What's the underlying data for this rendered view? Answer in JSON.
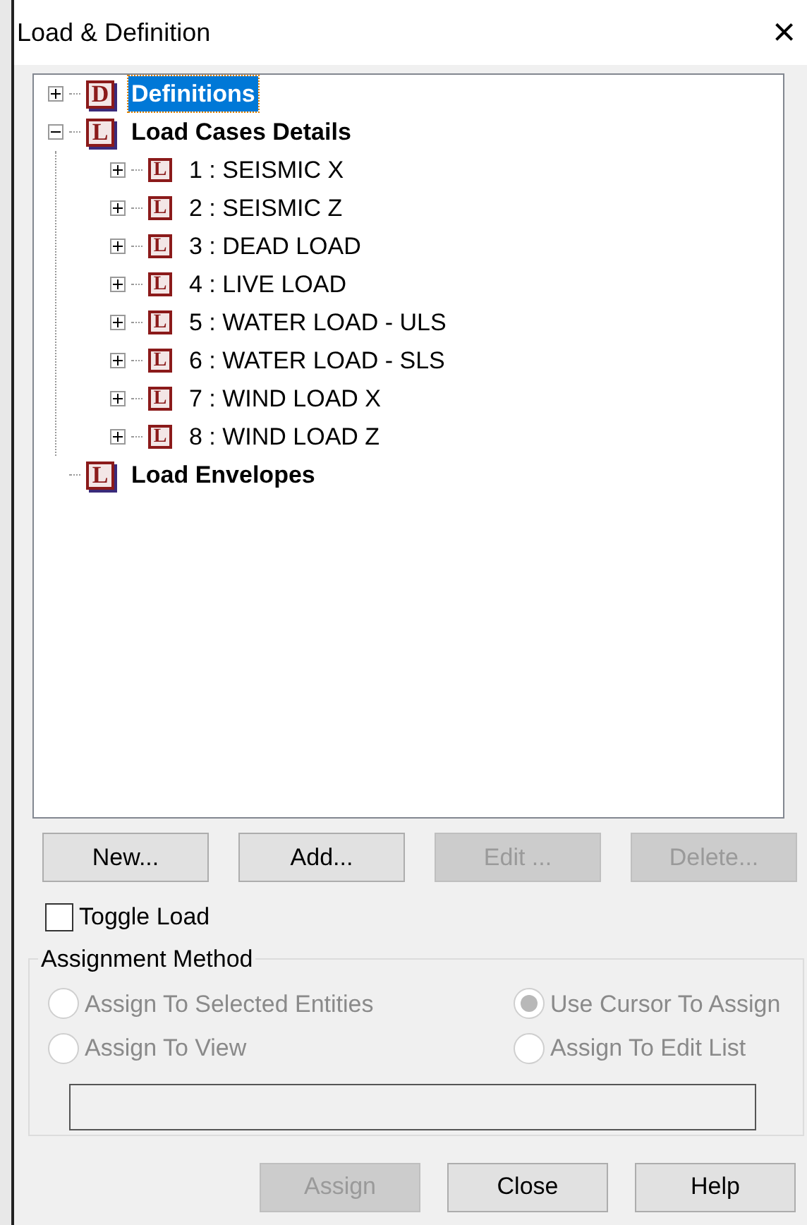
{
  "window": {
    "title": "Load & Definition",
    "close": "×"
  },
  "tree": [
    {
      "label": "Definitions",
      "badge": "D",
      "bold": true,
      "selected": true,
      "expanded": false,
      "has_toggle": true
    },
    {
      "label": "Load Cases Details",
      "badge": "L",
      "bold": true,
      "selected": false,
      "expanded": true,
      "has_toggle": true,
      "children": [
        {
          "label": "1 : SEISMIC X",
          "badge": "L",
          "bold": false,
          "selected": false,
          "expanded": false,
          "has_toggle": true
        },
        {
          "label": "2 : SEISMIC Z",
          "badge": "L",
          "bold": false,
          "selected": false,
          "expanded": false,
          "has_toggle": true
        },
        {
          "label": "3 : DEAD LOAD",
          "badge": "L",
          "bold": false,
          "selected": false,
          "expanded": false,
          "has_toggle": true
        },
        {
          "label": "4 : LIVE LOAD",
          "badge": "L",
          "bold": false,
          "selected": false,
          "expanded": false,
          "has_toggle": true
        },
        {
          "label": "5 : WATER LOAD - ULS",
          "badge": "L",
          "bold": false,
          "selected": false,
          "expanded": false,
          "has_toggle": true
        },
        {
          "label": "6 : WATER LOAD - SLS",
          "badge": "L",
          "bold": false,
          "selected": false,
          "expanded": false,
          "has_toggle": true
        },
        {
          "label": "7 : WIND LOAD X",
          "badge": "L",
          "bold": false,
          "selected": false,
          "expanded": false,
          "has_toggle": true
        },
        {
          "label": "8 : WIND LOAD Z",
          "badge": "L",
          "bold": false,
          "selected": false,
          "expanded": false,
          "has_toggle": true
        }
      ]
    },
    {
      "label": "Load Envelopes",
      "badge": "L",
      "bold": true,
      "selected": false,
      "has_toggle": false
    }
  ],
  "tree_buttons": [
    {
      "label": "New...",
      "disabled": false
    },
    {
      "label": "Add...",
      "disabled": false
    },
    {
      "label": "Edit ...",
      "disabled": true
    },
    {
      "label": "Delete...",
      "disabled": true
    }
  ],
  "toggle_load": {
    "label": "Toggle Load",
    "checked": false
  },
  "assignment_method": {
    "title": "Assignment Method",
    "disabled": true,
    "options": [
      {
        "label": "Assign To Selected Entities",
        "selected": false
      },
      {
        "label": "Use Cursor To Assign",
        "selected": true
      },
      {
        "label": "Assign To View",
        "selected": false
      },
      {
        "label": "Assign To Edit List",
        "selected": false
      }
    ]
  },
  "footer_buttons": [
    {
      "label": "Assign",
      "disabled": true
    },
    {
      "label": "Close",
      "disabled": false
    },
    {
      "label": "Help",
      "disabled": false
    }
  ]
}
